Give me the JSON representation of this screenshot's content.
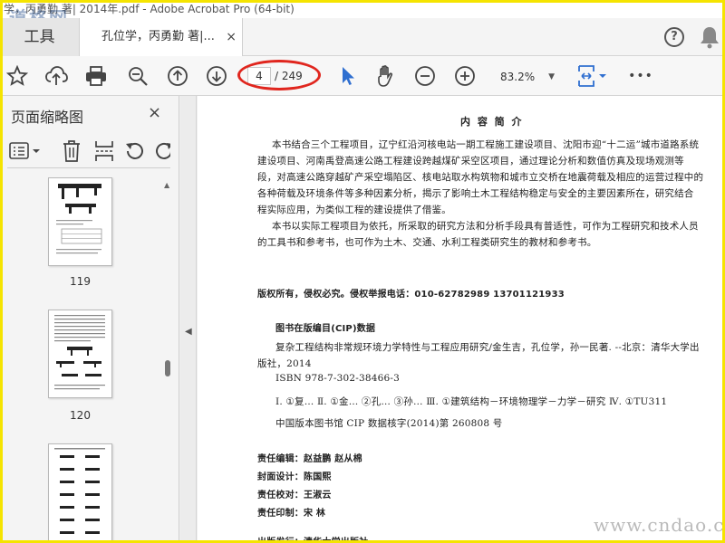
{
  "window": {
    "title": "学，丙勇勤 著| 2014年.pdf - Adobe Acrobat Pro (64-bit)",
    "watermark_tl": "道格网"
  },
  "tabs": {
    "tools": "工具",
    "document": "孔位学，丙勇勤 著|...",
    "close": "×"
  },
  "header_icons": {
    "help": "?",
    "help_icon": "help-icon",
    "bell_icon": "bell-icon"
  },
  "toolbar": {
    "page_current": "4",
    "page_total": "/ 249",
    "zoom": "83.2%",
    "zoom_caret": "▼",
    "more": "•••",
    "highlight_color": "#e0261e"
  },
  "sidebar": {
    "title": "页面缩略图",
    "close": "×",
    "thumbnails": [
      {
        "label": "119"
      },
      {
        "label": "120"
      },
      {
        "label": ""
      }
    ]
  },
  "page": {
    "heading": "内 容 简 介",
    "paragraph1": [
      "本书结合三个工程项目，辽宁红沿河核电站一期工程施工建设项目、沈阳市迎“十二运”城市道路系统",
      "建设项目、河南禹登高速公路工程建设跨越煤矿采空区项目，通过理论分析和数值仿真及现场观测等",
      "段，对高速公路穿越矿产采空塌陷区、核电站取水构筑物和城市立交桥在地震荷载及相应的运营过程中的",
      "各种荷载及环境条件等多种因素分析，揭示了影响土木工程结构稳定与安全的主要因素所在，研究结合",
      "程实际应用，为类似工程的建设提供了借鉴。"
    ],
    "paragraph2": [
      "本书以实际工程项目为依托，所采取的研究方法和分析手段具有普适性，可作为工程研究和技术人员",
      "的工具书和参考书，也可作为土木、交通、水利工程类研究生的教材和参考书。"
    ],
    "copyright": "版权所有，侵权必究。侵权举报电话：010-62782989    13701121933",
    "cip_title": "图书在版编目(CIP)数据",
    "cip_lines": [
      "复杂工程结构非常规环境力学特性与工程应用研究/金生吉，孔位学，孙一民著. --北京：清华大学出",
      "版社，2014",
      "ISBN 978-7-302-38466-3",
      "Ⅰ. ①复…  Ⅱ. ①金…  ②孔…  ③孙…   Ⅲ. ①建筑结构－环境物理学－力学－研究   Ⅳ. ①TU311",
      "中国版本图书馆 CIP 数据核字(2014)第 260808 号"
    ],
    "credits": [
      "责任编辑：赵益鹏    赵从棉",
      "封面设计：陈国熙",
      "责任校对：王淑云",
      "责任印制：宋    林"
    ],
    "publisher": "出版发行：清华大学出版社"
  },
  "watermark_br": "www.cndao.com"
}
